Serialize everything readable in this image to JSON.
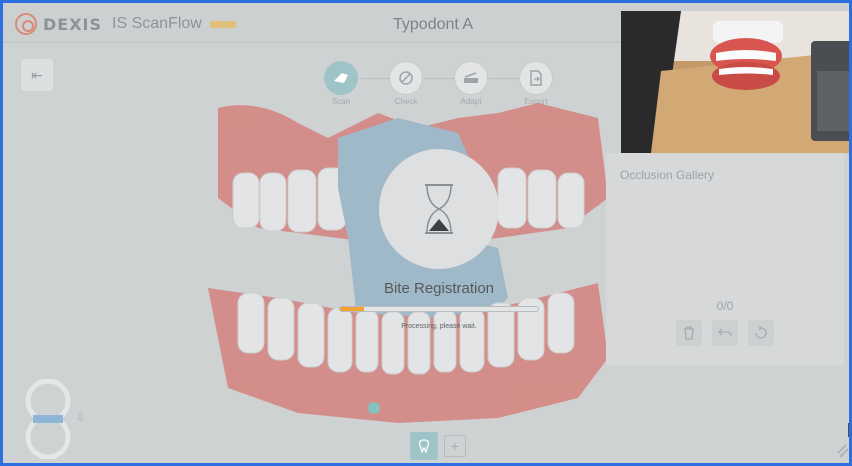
{
  "header": {
    "brand": "DEXIS",
    "product": "IS ScanFlow",
    "document_title": "Typodont A"
  },
  "workflow": {
    "steps": [
      {
        "label": "Scan",
        "icon": "scan-icon",
        "active": true
      },
      {
        "label": "Check",
        "icon": "check-icon",
        "active": false
      },
      {
        "label": "Adapt",
        "icon": "adapt-icon",
        "active": false
      },
      {
        "label": "Export",
        "icon": "export-icon",
        "active": false
      }
    ]
  },
  "processing": {
    "title": "Bite Registration",
    "status": "Processing, please wait.",
    "progress": 0.12,
    "icon": "hourglass-icon"
  },
  "gallery": {
    "title": "Occlusion Gallery",
    "count": "0/0"
  },
  "colors": {
    "accent": "#9fc4c8",
    "progress": "#f0a232",
    "window_border": "#2b6fe0",
    "gums": "#d8564f"
  }
}
